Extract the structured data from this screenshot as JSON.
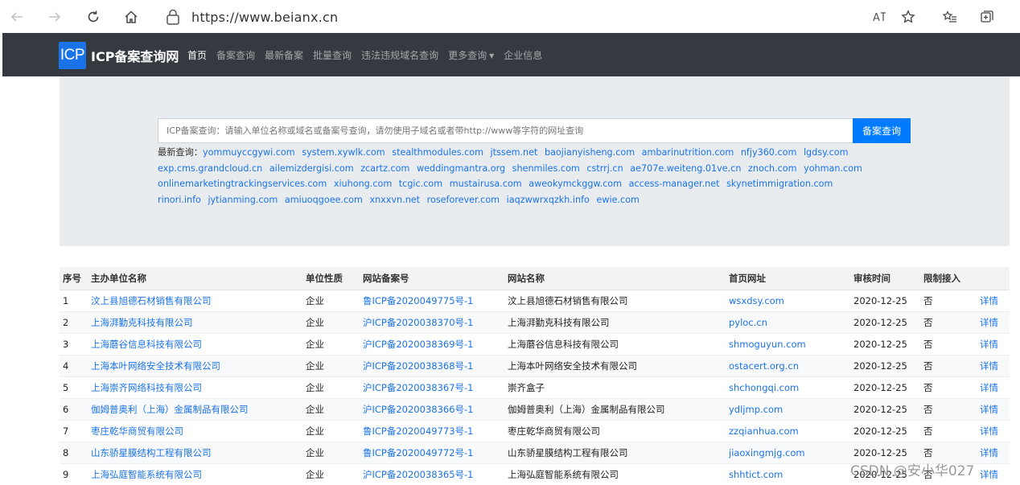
{
  "browser": {
    "url": "https://www.beianx.cn"
  },
  "navbar": {
    "logo_text": "ICP",
    "brand_name": "ICP备案查询网",
    "links": [
      "首页",
      "备案查询",
      "最新备案",
      "批量查询",
      "违法违规域名查询",
      "更多查询",
      "企业信息"
    ]
  },
  "search": {
    "placeholder": "ICP备案查询：请输入单位名称或域名或备案号查询，请勿使用子域名或者带http://www等字符的网址查询",
    "button_label": "备案查询"
  },
  "latest": {
    "label": "最新查询：",
    "items": [
      "yommuyccgywi.com",
      "system.xywlk.com",
      "stealthmodules.com",
      "jtssem.net",
      "baojianyisheng.com",
      "ambarinutrition.com",
      "nfjy360.com",
      "lgdsy.com",
      "exp.cms.grandcloud.cn",
      "ailemizdergisi.com",
      "zcartz.com",
      "weddingmantra.org",
      "shenmiles.com",
      "cstrrj.cn",
      "ae707e.weiteng.01ve.cn",
      "znoch.com",
      "yohman.com",
      "onlinemarketingtrackingservices.com",
      "xiuhong.com",
      "tcgic.com",
      "mustairusa.com",
      "aweokymckggw.com",
      "access-manager.net",
      "skynetimmigration.com",
      "rinori.info",
      "jytianming.com",
      "amiuoqgoee.com",
      "xnxxvn.net",
      "roseforever.com",
      "iaqzwwrxqzkh.info",
      "ewie.com"
    ]
  },
  "table": {
    "headers": [
      "序号",
      "主办单位名称",
      "单位性质",
      "网站备案号",
      "网站名称",
      "首页网址",
      "审核时间",
      "限制接入",
      ""
    ],
    "rows": [
      {
        "seq": "1",
        "org": "汶上县旭德石材销售有限公司",
        "type": "企业",
        "icp": "鲁ICP备2020049775号-1",
        "site": "汶上县旭德石材销售有限公司",
        "home": "wsxdsy.com",
        "time": "2020-12-25",
        "limit": "否",
        "detail": "详情"
      },
      {
        "seq": "2",
        "org": "上海湃勤克科技有限公司",
        "type": "企业",
        "icp": "沪ICP备2020038370号-1",
        "site": "上海湃勤克科技有限公司",
        "home": "pyloc.cn",
        "time": "2020-12-25",
        "limit": "否",
        "detail": "详情"
      },
      {
        "seq": "3",
        "org": "上海蘑谷信息科技有限公司",
        "type": "企业",
        "icp": "沪ICP备2020038369号-1",
        "site": "上海蘑谷信息科技有限公司",
        "home": "shmoguyun.com",
        "time": "2020-12-25",
        "limit": "否",
        "detail": "详情"
      },
      {
        "seq": "4",
        "org": "上海本叶网络安全技术有限公司",
        "type": "企业",
        "icp": "沪ICP备2020038368号-1",
        "site": "上海本叶网络安全技术有限公司",
        "home": "ostacert.org.cn",
        "time": "2020-12-25",
        "limit": "否",
        "detail": "详情"
      },
      {
        "seq": "5",
        "org": "上海崇齐网络科技有限公司",
        "type": "企业",
        "icp": "沪ICP备2020038367号-1",
        "site": "崇齐盒子",
        "home": "shchongqi.com",
        "time": "2020-12-25",
        "limit": "否",
        "detail": "详情"
      },
      {
        "seq": "6",
        "org": "伽姆普奥利（上海）金属制品有限公司",
        "type": "企业",
        "icp": "沪ICP备2020038366号-1",
        "site": "伽姆普奥利（上海）金属制品有限公司",
        "home": "ydljmp.com",
        "time": "2020-12-25",
        "limit": "否",
        "detail": "详情"
      },
      {
        "seq": "7",
        "org": "枣庄乾华商贸有限公司",
        "type": "企业",
        "icp": "鲁ICP备2020049773号-1",
        "site": "枣庄乾华商贸有限公司",
        "home": "zzqianhua.com",
        "time": "2020-12-25",
        "limit": "否",
        "detail": "详情"
      },
      {
        "seq": "8",
        "org": "山东骄星膜结构工程有限公司",
        "type": "企业",
        "icp": "鲁ICP备2020049772号-1",
        "site": "山东骄星膜结构工程有限公司",
        "home": "jiaoxingmjg.com",
        "time": "2020-12-25",
        "limit": "否",
        "detail": "详情"
      },
      {
        "seq": "9",
        "org": "上海弘庭智能系统有限公司",
        "type": "企业",
        "icp": "沪ICP备2020038365号-1",
        "site": "上海弘庭智能系统有限公司",
        "home": "shhtict.com",
        "time": "2020-12-25",
        "limit": "否",
        "detail": "详情"
      }
    ]
  },
  "watermark": "CSDN @安小华027"
}
